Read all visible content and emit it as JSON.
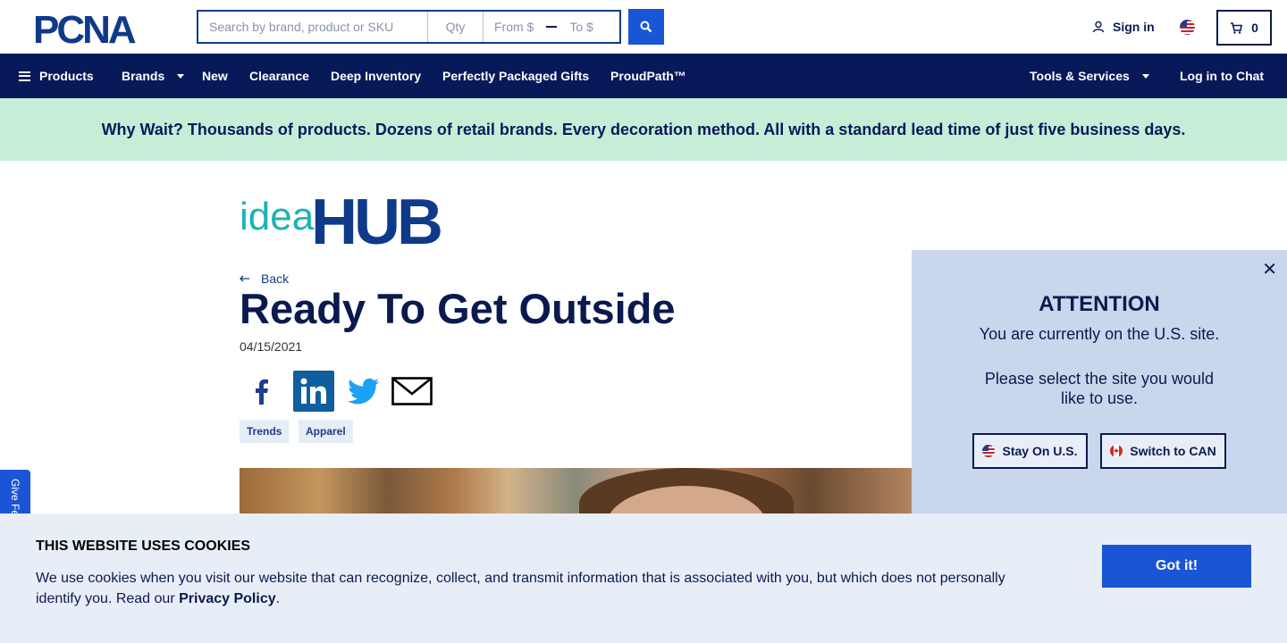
{
  "brand": {
    "logo_text": "PCNA"
  },
  "search": {
    "keyword_placeholder": "Search by brand, product or SKU",
    "qty_placeholder": "Qty",
    "from_placeholder": "From $",
    "to_placeholder": "To $"
  },
  "header": {
    "signin_label": "Sign in",
    "cart_count": "0"
  },
  "nav": {
    "products": "Products",
    "brands": "Brands",
    "new": "New",
    "clearance": "Clearance",
    "deep_inventory": "Deep Inventory",
    "gifts": "Perfectly Packaged Gifts",
    "proudpath": "ProudPath™",
    "tools": "Tools & Services",
    "chat": "Log in to Chat"
  },
  "banner": {
    "text": "Why Wait? Thousands of products. Dozens of retail brands. Every decoration method. All with a standard lead time of just five business days."
  },
  "article": {
    "hub_logo": {
      "part1": "idea",
      "part2": "HUB"
    },
    "back_label": "Back",
    "title": "Ready To Get Outside",
    "date": "04/15/2021",
    "tags": [
      "Trends",
      "Apparel"
    ]
  },
  "feedback": {
    "label": "Give Feedback"
  },
  "attention": {
    "heading": "ATTENTION",
    "line1": "You are currently on the U.S. site.",
    "line2": "Please select the site you would like to use.",
    "stay_label": "Stay On U.S.",
    "switch_label": "Switch to CAN"
  },
  "cookies": {
    "heading": "THIS WEBSITE USES COOKIES",
    "body": "We use cookies when you visit our website that can recognize, collect, and transmit information that is associated with you, but which does not personally identify you. Read our ",
    "link": "Privacy Policy",
    "end": ".",
    "button": "Got it!"
  },
  "colors": {
    "navy": "#08195a",
    "blue": "#1a55d6",
    "mint": "#c6eed7",
    "teal": "#1bb3b3"
  }
}
